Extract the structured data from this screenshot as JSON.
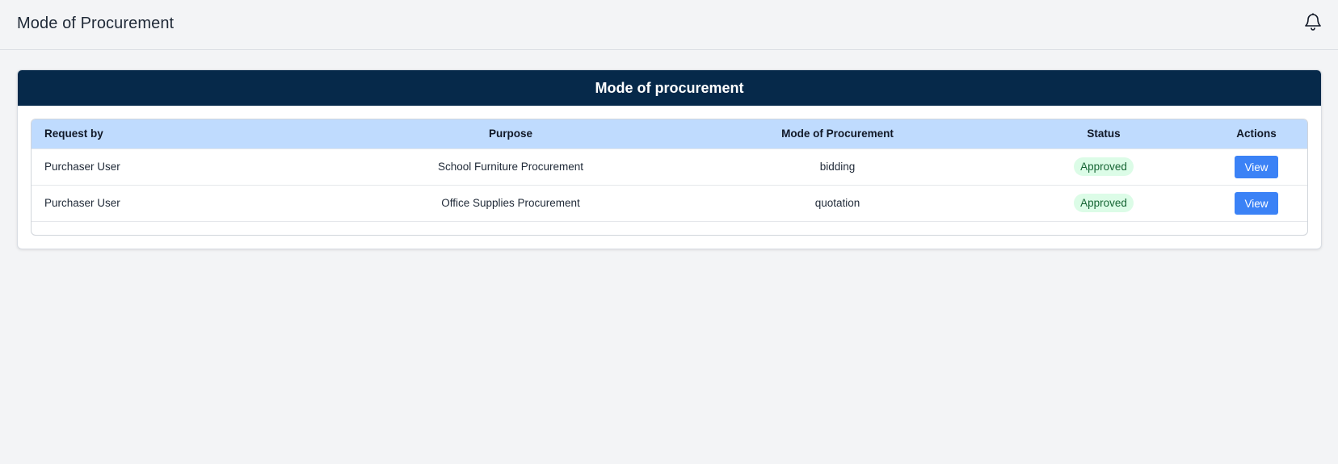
{
  "header": {
    "title": "Mode of Procurement",
    "notification_icon": "bell-icon"
  },
  "card": {
    "title": "Mode of procurement"
  },
  "table": {
    "columns": [
      "Request by",
      "Purpose",
      "Mode of Procurement",
      "Status",
      "Actions"
    ],
    "rows": [
      {
        "request_by": "Purchaser User",
        "purpose": "School Furniture Procurement",
        "mode": "bidding",
        "status": "Approved",
        "action": "View"
      },
      {
        "request_by": "Purchaser User",
        "purpose": "Office Supplies Procurement",
        "mode": "quotation",
        "status": "Approved",
        "action": "View"
      }
    ]
  },
  "colors": {
    "header_bg": "#06294a",
    "table_header_bg": "#bfdbfe",
    "status_approved_bg": "#dcfce7",
    "status_approved_text": "#166534",
    "button_bg": "#3b82f6"
  }
}
